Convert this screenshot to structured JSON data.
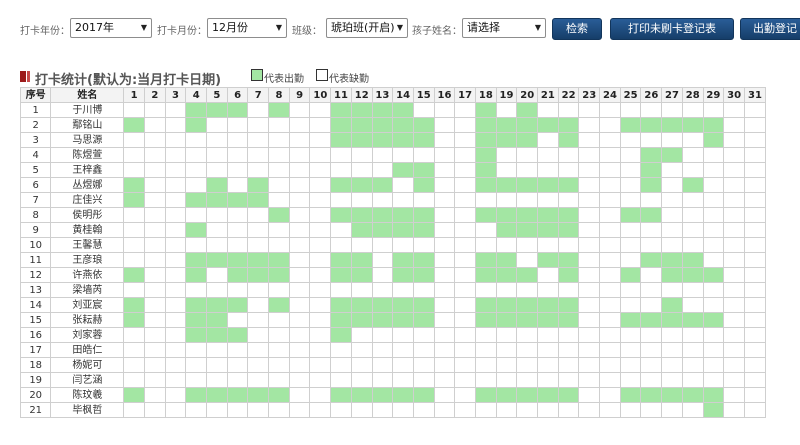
{
  "filters": {
    "year_label": "打卡年份：",
    "year_value": "2017年",
    "month_label": "打卡月份：",
    "month_value": "12月份",
    "class_label": "班级：",
    "class_value": "琥珀班(开启)",
    "child_label": "孩子姓名：",
    "child_value": "请选择",
    "search_button": "检索",
    "print_button": "打印未刷卡登记表",
    "attendance_button": "出勤登记"
  },
  "section": {
    "title": "打卡统计(默认为:当月打卡日期)",
    "legend_present": "代表出勤",
    "legend_absent": "代表缺勤"
  },
  "colors": {
    "present": "#a3e6a3",
    "absent": "#ffffff",
    "button": "#1f4b7e"
  },
  "table": {
    "col_index": "序号",
    "col_name": "姓名",
    "days": [
      "1",
      "2",
      "3",
      "4",
      "5",
      "6",
      "7",
      "8",
      "9",
      "10",
      "11",
      "12",
      "13",
      "14",
      "15",
      "16",
      "17",
      "18",
      "19",
      "20",
      "21",
      "22",
      "23",
      "24",
      "25",
      "26",
      "27",
      "28",
      "29",
      "30",
      "31"
    ],
    "rows": [
      {
        "index": "1",
        "name": "于川博",
        "present": [
          4,
          5,
          6,
          8,
          11,
          12,
          13,
          14,
          18,
          20
        ]
      },
      {
        "index": "2",
        "name": "鄢铭山",
        "present": [
          1,
          4,
          11,
          12,
          13,
          14,
          15,
          18,
          19,
          20,
          21,
          22,
          25,
          26,
          27,
          28,
          29
        ]
      },
      {
        "index": "3",
        "name": "马思源",
        "present": [
          11,
          12,
          13,
          14,
          15,
          18,
          19,
          20,
          22,
          29
        ]
      },
      {
        "index": "4",
        "name": "陈煜萱",
        "present": [
          18,
          26,
          27
        ]
      },
      {
        "index": "5",
        "name": "王梓鑫",
        "present": [
          14,
          15,
          18,
          26
        ]
      },
      {
        "index": "6",
        "name": "丛煜娜",
        "present": [
          1,
          5,
          7,
          11,
          12,
          13,
          15,
          18,
          19,
          20,
          21,
          22,
          26,
          28
        ]
      },
      {
        "index": "7",
        "name": "庄佳兴",
        "present": [
          1,
          4,
          5,
          6,
          7
        ]
      },
      {
        "index": "8",
        "name": "侯明彤",
        "present": [
          8,
          11,
          12,
          13,
          14,
          15,
          18,
          19,
          20,
          21,
          22,
          25,
          26
        ]
      },
      {
        "index": "9",
        "name": "黄桂翰",
        "present": [
          4,
          12,
          13,
          14,
          15,
          19,
          20,
          21,
          22
        ]
      },
      {
        "index": "10",
        "name": "王馨慧",
        "present": []
      },
      {
        "index": "11",
        "name": "王彦琅",
        "present": [
          4,
          5,
          6,
          7,
          8,
          11,
          12,
          14,
          15,
          18,
          19,
          21,
          22,
          26,
          27,
          28
        ]
      },
      {
        "index": "12",
        "name": "许燕依",
        "present": [
          1,
          4,
          6,
          7,
          8,
          11,
          12,
          14,
          15,
          18,
          19,
          20,
          22,
          25,
          27,
          28,
          29
        ]
      },
      {
        "index": "13",
        "name": "梁墙芮",
        "present": []
      },
      {
        "index": "14",
        "name": "刘亚宸",
        "present": [
          1,
          4,
          5,
          6,
          8,
          11,
          12,
          13,
          14,
          15,
          18,
          19,
          20,
          21,
          22,
          27
        ]
      },
      {
        "index": "15",
        "name": "张耘赫",
        "present": [
          1,
          4,
          5,
          11,
          12,
          13,
          14,
          15,
          18,
          19,
          20,
          21,
          22,
          25,
          26,
          27,
          28,
          29
        ]
      },
      {
        "index": "16",
        "name": "刘家蓉",
        "present": [
          4,
          5,
          6,
          11
        ]
      },
      {
        "index": "17",
        "name": "田皓仁",
        "present": []
      },
      {
        "index": "18",
        "name": "杨妮可",
        "present": []
      },
      {
        "index": "19",
        "name": "闫艺涵",
        "present": []
      },
      {
        "index": "20",
        "name": "陈玟羲",
        "present": [
          1,
          4,
          5,
          6,
          7,
          8,
          11,
          12,
          13,
          14,
          15,
          18,
          19,
          20,
          21,
          22,
          25,
          26,
          27,
          28,
          29
        ]
      },
      {
        "index": "21",
        "name": "毕枫哲",
        "present": [
          29
        ]
      }
    ]
  }
}
